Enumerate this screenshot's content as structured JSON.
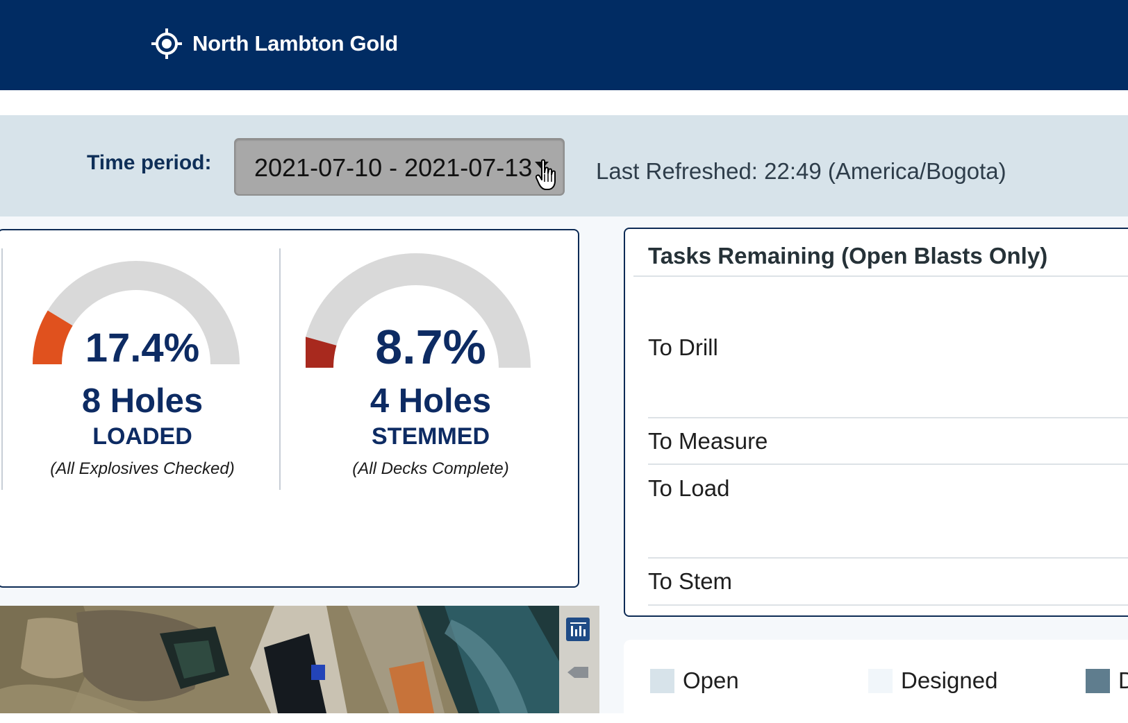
{
  "header": {
    "brand_icon": "crosshair-icon",
    "brand_name": "North Lambton Gold"
  },
  "filter": {
    "time_period_label": "Time period:",
    "time_period_value": "2021-07-10 - 2021-07-13",
    "dropdown_icon": "caret-down-icon",
    "last_refreshed": "Last Refreshed: 22:49 (America/Bogota)"
  },
  "gauges": [
    {
      "percent_text": "17.4%",
      "fraction": 0.174,
      "holes": "8 Holes",
      "status": "LOADED",
      "note": "(All Explosives Checked)",
      "color": "#e0511e"
    },
    {
      "percent_text": "8.7%",
      "fraction": 0.087,
      "holes": "4 Holes",
      "status": "STEMMED",
      "note": "(All Decks Complete)",
      "color": "#a8291e"
    }
  ],
  "tasks": {
    "title": "Tasks Remaining (Open Blasts Only)",
    "items": [
      "To Drill",
      "To Measure",
      "To Load",
      "To Stem"
    ]
  },
  "map": {
    "tool_icon": "layers-toolbar-icon"
  },
  "legend": {
    "items": [
      {
        "label": "Open",
        "color": "#d7e3ea"
      },
      {
        "label": "Designed",
        "color": "#f1f6fa"
      },
      {
        "label": "D",
        "color": "#5f7d8e"
      }
    ]
  },
  "colors": {
    "header_bg": "#012c63",
    "filter_bg": "#d7e3ea",
    "text_navy": "#0d2b63",
    "gauge_track": "#d9d9d9"
  }
}
